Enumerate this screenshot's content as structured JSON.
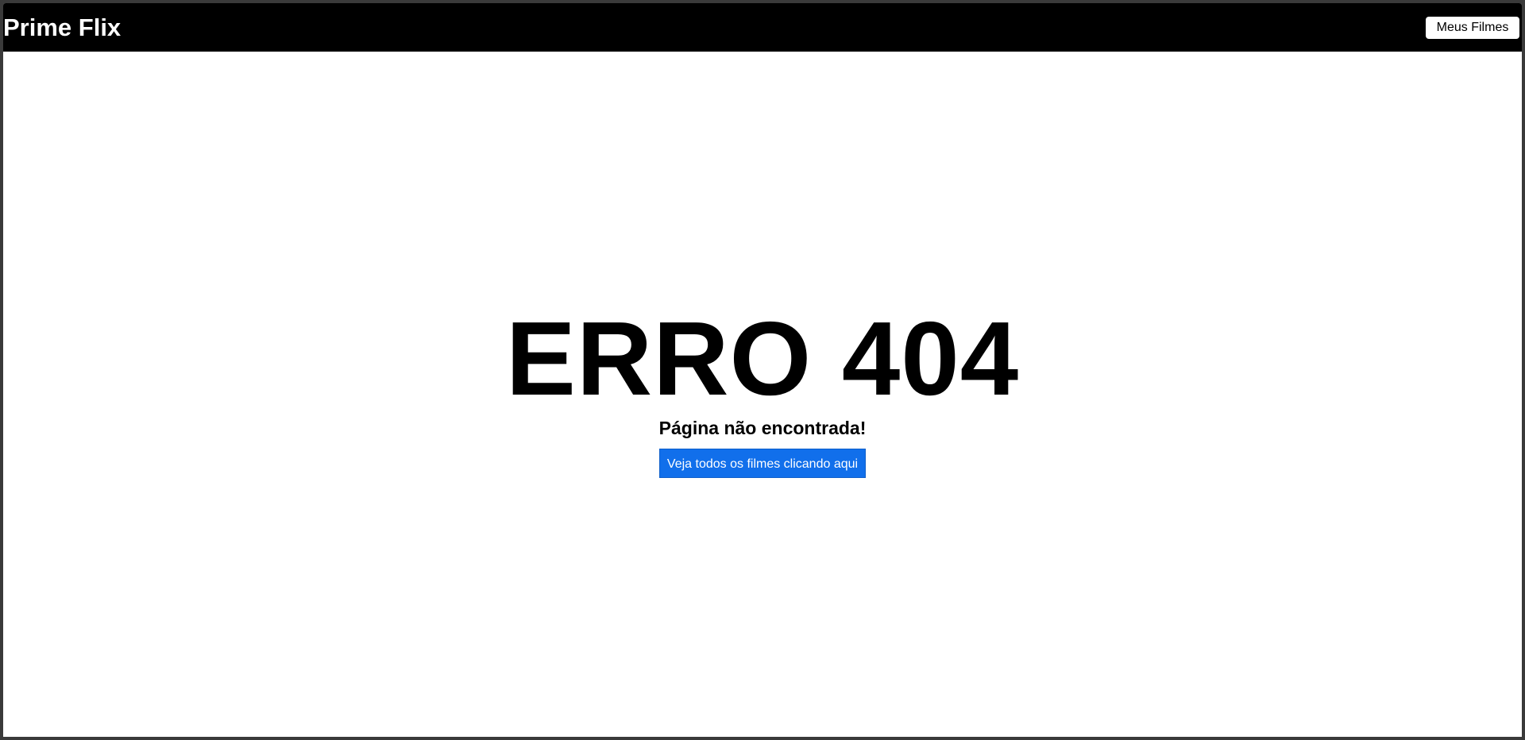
{
  "header": {
    "brand": "Prime Flix",
    "my_films_label": "Meus Filmes"
  },
  "main": {
    "title": "ERRO 404",
    "subtitle": "Página não encontrada!",
    "cta_label": "Veja todos os filmes clicando aqui"
  },
  "colors": {
    "header_background": "#000000",
    "page_background": "#ffffff",
    "cta_background": "#116feb",
    "cta_text": "#ffffff"
  }
}
